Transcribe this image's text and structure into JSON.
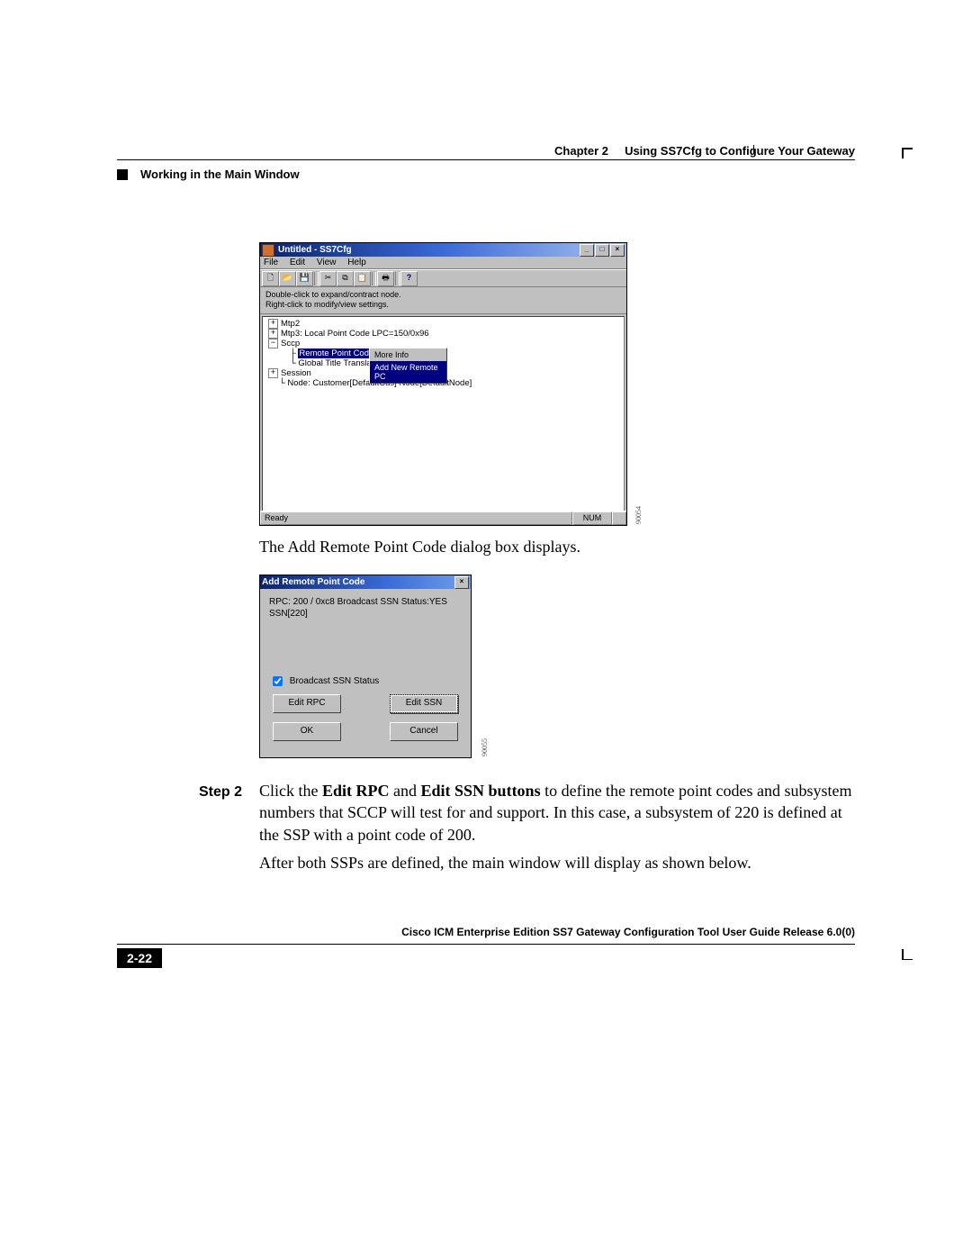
{
  "header": {
    "chapter": "Chapter 2",
    "title": "Using SS7Cfg to Configure Your Gateway",
    "section": "Working in the Main Window"
  },
  "win": {
    "title": "Untitled - SS7Cfg",
    "menu": {
      "file": "File",
      "edit": "Edit",
      "view": "View",
      "help": "Help"
    },
    "hint1": "Double-click to expand/contract node.",
    "hint2": "Right-click to modify/view settings.",
    "tree": {
      "n0": "Mtp2",
      "n1": "Mtp3: Local Point Code LPC=150/0x96",
      "n2": "Sccp",
      "n2a": "Remote Point Codes",
      "n2b": "Global Title Translatio",
      "n3": "Session",
      "n4": "Node:  Customer[DefaultCus] Node[DefaultNode]"
    },
    "ctx": {
      "i0": "More Info",
      "i1": "Add New Remote PC"
    },
    "status": {
      "ready": "Ready",
      "num": "NUM"
    },
    "figid": "90054"
  },
  "caption1": "The Add Remote Point Code dialog box displays.",
  "dlg": {
    "title": "Add Remote Point Code",
    "l1": "RPC: 200 / 0xc8  Broadcast SSN Status:YES",
    "l2": "SSN[220]",
    "chk": "Broadcast SSN Status",
    "b_editrpc": "Edit RPC",
    "b_editssn": "Edit SSN",
    "b_ok": "OK",
    "b_cancel": "Cancel",
    "figid": "90055"
  },
  "step": {
    "label": "Step 2",
    "p1a": "Click the ",
    "p1b": "Edit RPC",
    "p1c": " and ",
    "p1d": "Edit SSN buttons",
    "p1e": " to define the remote point codes and subsystem numbers that SCCP will test for and support. In this case, a subsystem of 220 is defined at the SSP with a point code of 200.",
    "p2": "After both SSPs are defined, the main window will display as shown below."
  },
  "footer": {
    "book": "Cisco ICM Enterprise Edition SS7 Gateway Configuration Tool User Guide Release 6.0(0)",
    "page": "2-22"
  }
}
